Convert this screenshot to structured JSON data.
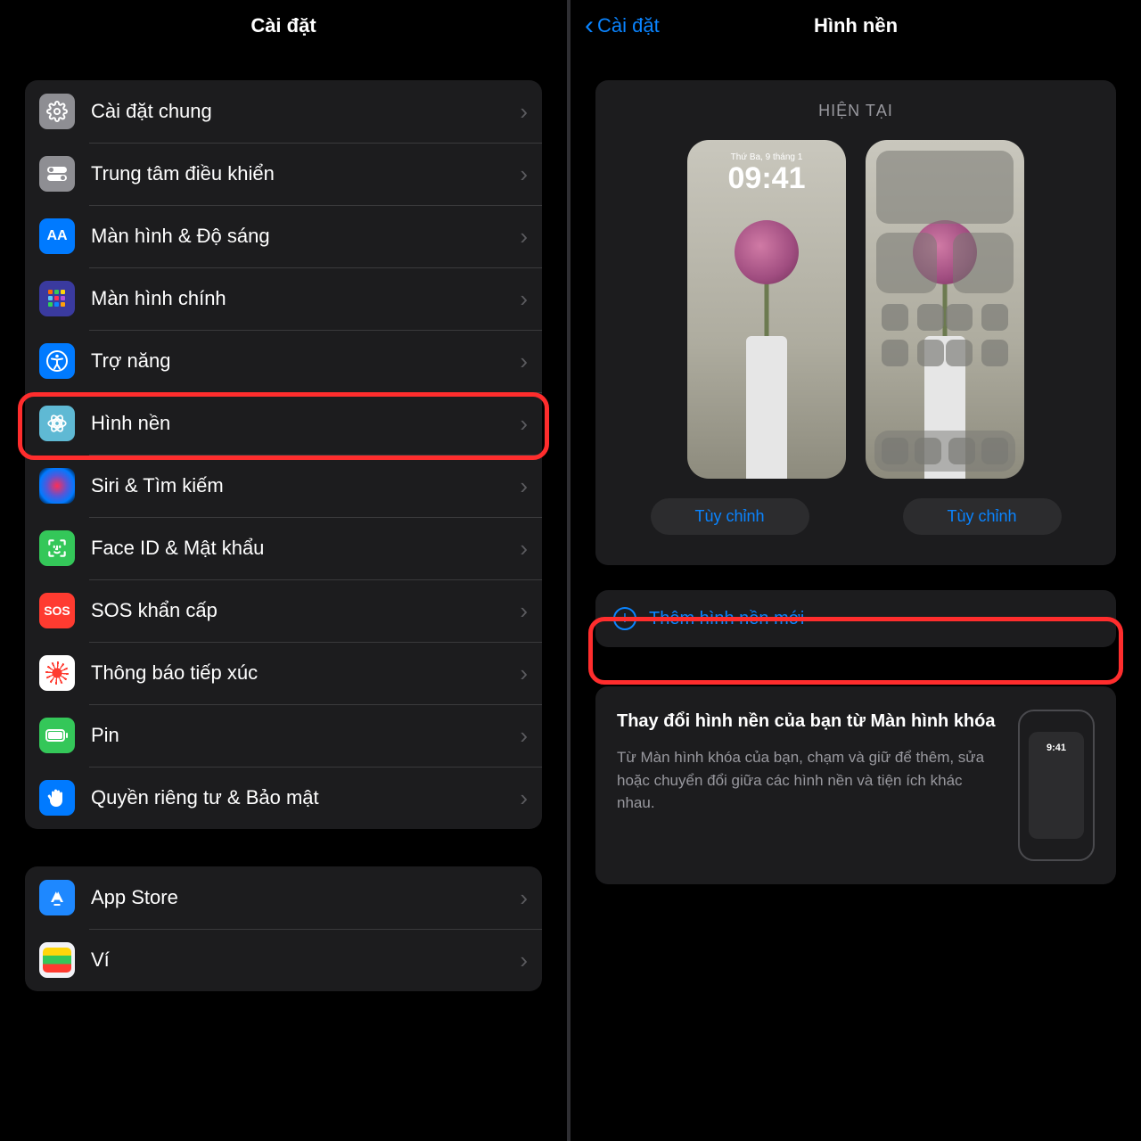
{
  "left": {
    "title": "Cài đặt",
    "group1": [
      {
        "label": "Cài đặt chung"
      },
      {
        "label": "Trung tâm điều khiển"
      },
      {
        "label": "Màn hình & Độ sáng"
      },
      {
        "label": "Màn hình chính"
      },
      {
        "label": "Trợ năng"
      },
      {
        "label": "Hình nền"
      },
      {
        "label": "Siri & Tìm kiếm"
      },
      {
        "label": "Face ID & Mật khẩu"
      },
      {
        "label": "SOS khẩn cấp"
      },
      {
        "label": "Thông báo tiếp xúc"
      },
      {
        "label": "Pin"
      },
      {
        "label": "Quyền riêng tư & Bảo mật"
      }
    ],
    "group2": [
      {
        "label": "App Store"
      },
      {
        "label": "Ví"
      }
    ]
  },
  "right": {
    "back": "Cài đặt",
    "title": "Hình nền",
    "current_header": "HIỆN TẠI",
    "lock_date": "Thứ Ba, 9 tháng 1",
    "lock_time": "09:41",
    "customize": "Tùy chỉnh",
    "add_new": "Thêm hình nền mới",
    "tip_title": "Thay đổi hình nền của bạn từ Màn hình khóa",
    "tip_body": "Từ Màn hình khóa của bạn, chạm và giữ để thêm, sửa hoặc chuyển đổi giữa các hình nền và tiện ích khác nhau.",
    "tip_time": "9:41"
  }
}
